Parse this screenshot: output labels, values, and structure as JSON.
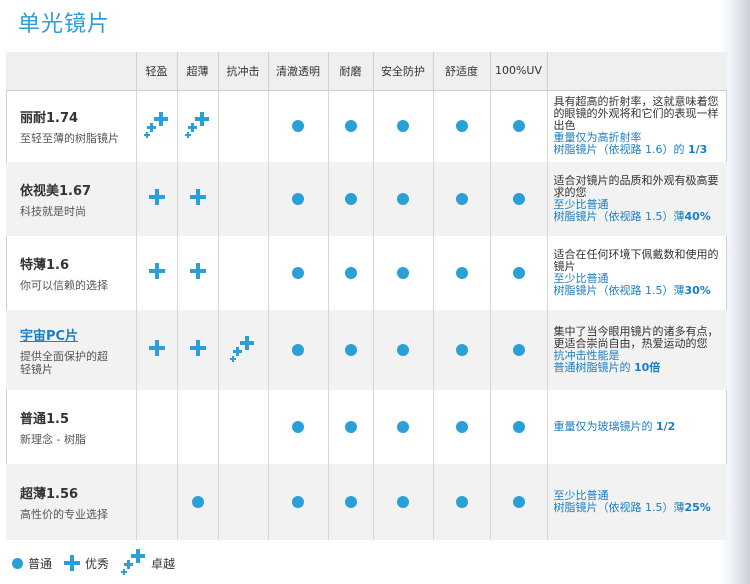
{
  "title": "单光镜片",
  "columns": [
    "轻盈",
    "超薄",
    "抗冲击",
    "清澈透明",
    "耐磨",
    "安全防护",
    "舒适度",
    "100%UV"
  ],
  "rating_icons": {
    "dot": "circle-dot-icon",
    "plus": "plus-icon",
    "star": "sparkle-plus-icon",
    "color": "#2a9fd8"
  },
  "rows": [
    {
      "name": "丽耐1.74",
      "sub": "至轻至薄的树脂镜片",
      "ratings": [
        "star",
        "star",
        "",
        "dot",
        "dot",
        "dot",
        "dot",
        "dot"
      ],
      "desc": "具有超高的折射率，这就意味着您的眼镜的外观将和它们的表现一样出色",
      "highlight1": "重量仅为高折射率",
      "highlight2": "树脂镜片（依视路 1.6）的 ",
      "highlight2_bold": "1/3"
    },
    {
      "name": "依视美1.67",
      "sub": "科技就是时尚",
      "ratings": [
        "plus",
        "plus",
        "",
        "dot",
        "dot",
        "dot",
        "dot",
        "dot"
      ],
      "desc": "适合对镜片的品质和外观有极高要求的您",
      "highlight1": "至少比普通",
      "highlight2": "树脂镜片（依视路 1.5）薄",
      "highlight2_bold": "40%"
    },
    {
      "name": "特薄1.6",
      "sub": "你可以信赖的选择",
      "ratings": [
        "plus",
        "plus",
        "",
        "dot",
        "dot",
        "dot",
        "dot",
        "dot"
      ],
      "desc": "适合在任何环境下佩戴数和使用的镜片",
      "highlight1": "至少比普通",
      "highlight2": "树脂镜片（依视路 1.5）薄",
      "highlight2_bold": "30%"
    },
    {
      "name": "宇宙PC片",
      "sub": "提供全面保护的超轻镜片",
      "ratings": [
        "plus",
        "plus",
        "star",
        "dot",
        "dot",
        "dot",
        "dot",
        "dot"
      ],
      "desc": "集中了当今眼用镜片的诸多有点，更适合崇尚自由，热爱运动的您",
      "highlight1": "抗冲击性能是",
      "highlight2": "普通树脂镜片的 ",
      "highlight2_bold": "10倍"
    },
    {
      "name": "普通1.5",
      "sub": "新理念 - 树脂",
      "ratings": [
        "",
        "",
        "",
        "dot",
        "dot",
        "dot",
        "dot",
        "dot"
      ],
      "desc": "",
      "highlight1": "",
      "highlight2": "重量仅为玻璃镜片的 ",
      "highlight2_bold": "1/2"
    },
    {
      "name": "超薄1.56",
      "sub": "高性价的专业选择",
      "ratings": [
        "",
        "dot",
        "",
        "dot",
        "dot",
        "dot",
        "dot",
        "dot"
      ],
      "desc": "",
      "highlight1": "至少比普通",
      "highlight2": "树脂镜片（依视路 1.5）薄",
      "highlight2_bold": "25%"
    }
  ],
  "legend": [
    {
      "type": "dot",
      "label": "普通"
    },
    {
      "type": "plus",
      "label": "优秀"
    },
    {
      "type": "star",
      "label": "卓越"
    }
  ]
}
